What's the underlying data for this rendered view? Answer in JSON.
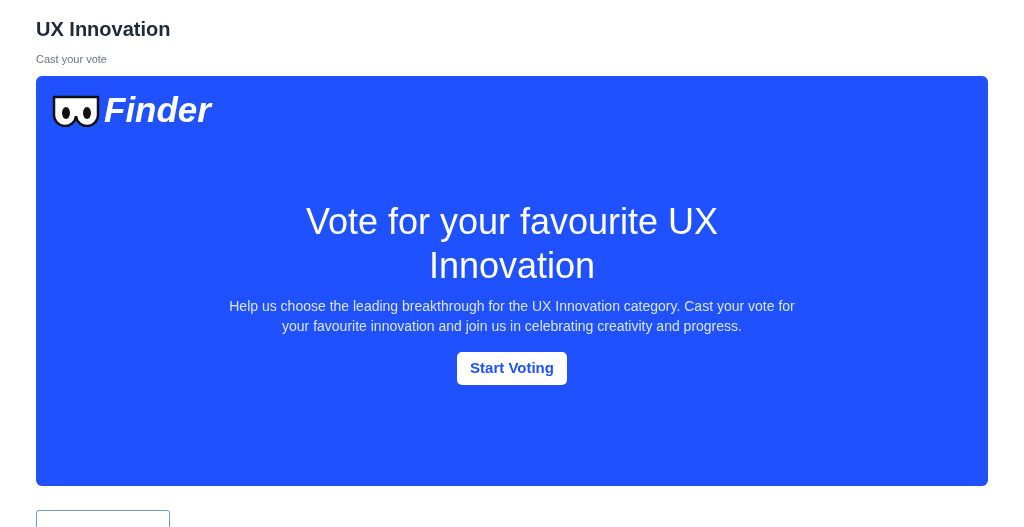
{
  "header": {
    "title": "UX Innovation",
    "subtitle": "Cast your vote"
  },
  "banner": {
    "logo_text": "Finder",
    "heading": "Vote for your favourite UX Innovation",
    "description": "Help us choose the leading breakthrough for the UX Innovation category. Cast your vote for your favourite innovation and join us in celebrating creativity and progress.",
    "button": "Start Voting"
  }
}
